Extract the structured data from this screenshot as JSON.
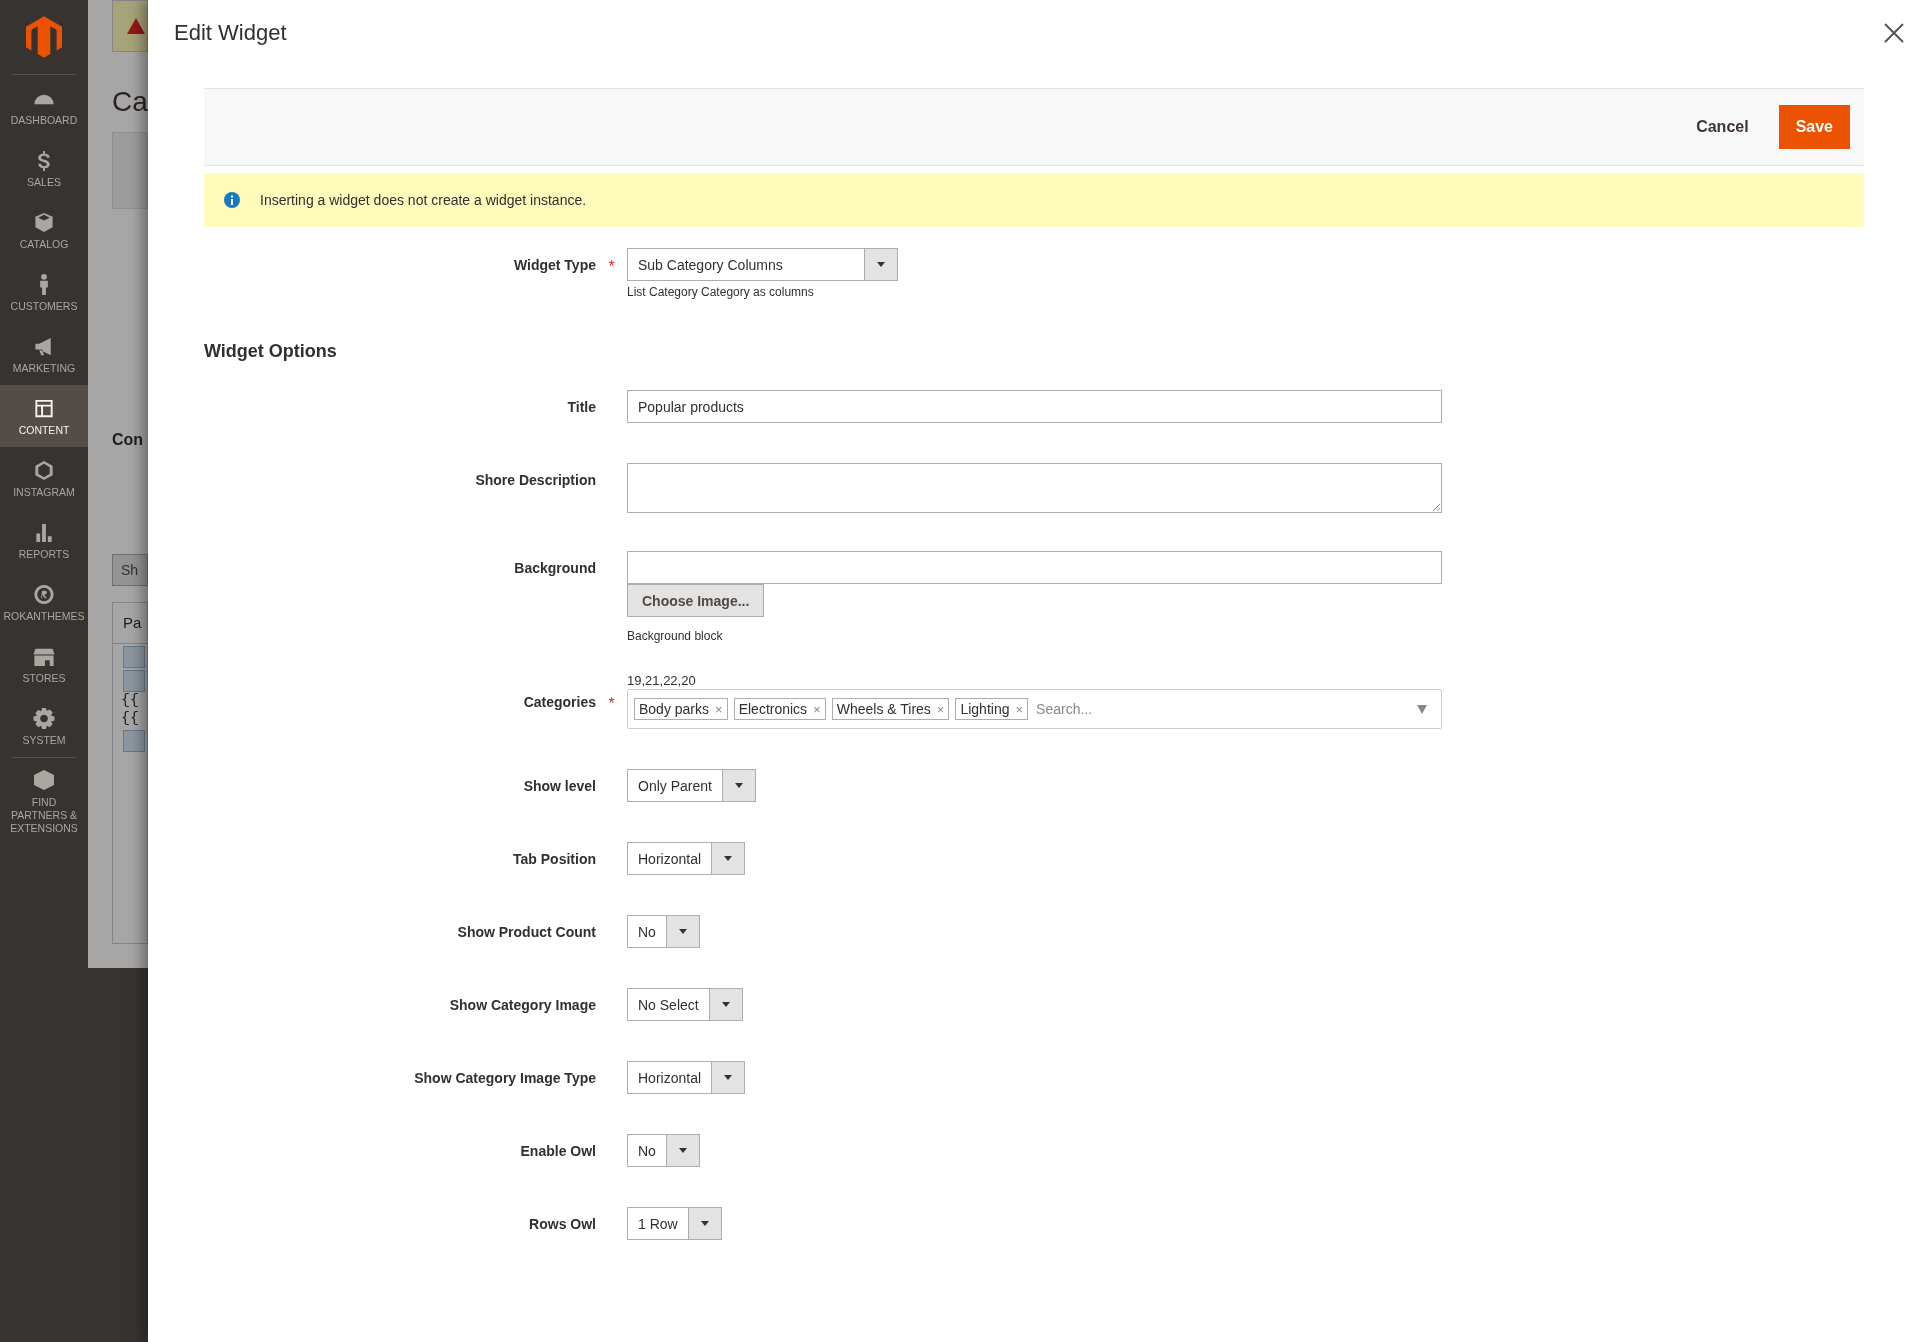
{
  "sidebar": {
    "items": [
      {
        "label": "DASHBOARD",
        "selected": false
      },
      {
        "label": "SALES",
        "selected": false
      },
      {
        "label": "CATALOG",
        "selected": false
      },
      {
        "label": "CUSTOMERS",
        "selected": false
      },
      {
        "label": "MARKETING",
        "selected": false
      },
      {
        "label": "CONTENT",
        "selected": true
      },
      {
        "label": "INSTAGRAM",
        "selected": false
      },
      {
        "label": "REPORTS",
        "selected": false
      },
      {
        "label": "ROKANTHEMES",
        "selected": false
      },
      {
        "label": "STORES",
        "selected": false
      },
      {
        "label": "SYSTEM",
        "selected": false
      },
      {
        "label": "FIND PARTNERS & EXTENSIONS",
        "selected": false
      }
    ]
  },
  "background_page": {
    "heading": "Ca",
    "section": "Con",
    "button": "Sh",
    "tab": "Pa",
    "code_lines": [
      "{{",
      "{{"
    ]
  },
  "modal": {
    "title": "Edit Widget",
    "toolbar": {
      "cancel": "Cancel",
      "save": "Save"
    },
    "notice": "Inserting a widget does not create a widget instance.",
    "required_mark": "*",
    "widget_type": {
      "label": "Widget Type",
      "required": true,
      "value": "Sub Category Columns",
      "note": "List Category Category as columns"
    },
    "options_heading": "Widget Options",
    "fields": [
      {
        "kind": "text",
        "label": "Title",
        "required": false,
        "value": "Popular products"
      },
      {
        "kind": "textarea",
        "label": "Shore Description",
        "required": false
      },
      {
        "kind": "image",
        "label": "Background",
        "required": false,
        "button": "Choose Image...",
        "note": "Background block"
      },
      {
        "kind": "multiselect",
        "label": "Categories",
        "required": true,
        "value": "19,21,22,20",
        "tags": [
          {
            "label": "Body parks",
            "remove": "×"
          },
          {
            "label": "Electronics",
            "remove": "×"
          },
          {
            "label": "Wheels & Tires",
            "remove": "×"
          },
          {
            "label": "Lighting",
            "remove": "×"
          }
        ],
        "placeholder": "Search..."
      },
      {
        "kind": "select",
        "label": "Show level",
        "required": false,
        "value": "Only Parent"
      },
      {
        "kind": "select",
        "label": "Tab Position",
        "required": false,
        "value": "Horizontal"
      },
      {
        "kind": "select",
        "label": "Show Product Count",
        "required": false,
        "value": "No"
      },
      {
        "kind": "select",
        "label": "Show Category Image",
        "required": false,
        "value": "No Select"
      },
      {
        "kind": "select",
        "label": "Show Category Image Type",
        "required": false,
        "value": "Horizontal"
      },
      {
        "kind": "select",
        "label": "Enable Owl",
        "required": false,
        "value": "No"
      },
      {
        "kind": "select",
        "label": "Rows Owl",
        "required": false,
        "value": "1 Row"
      }
    ]
  }
}
